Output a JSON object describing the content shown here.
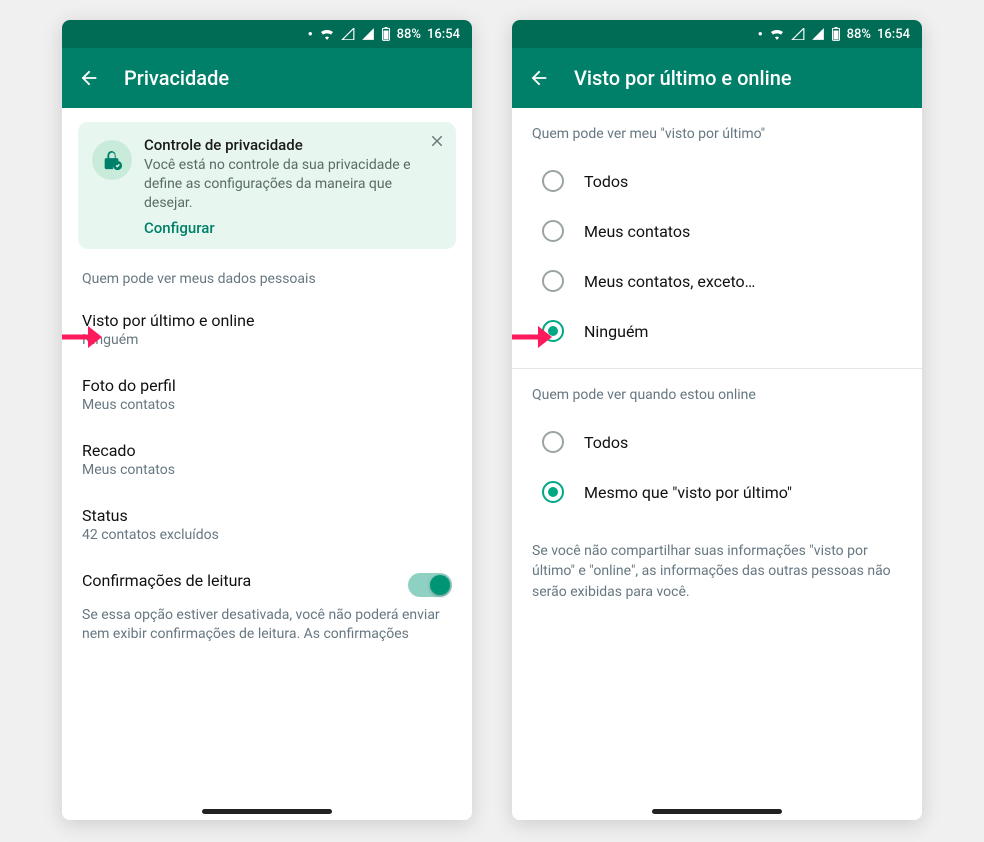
{
  "status": {
    "battery": "88%",
    "time": "16:54"
  },
  "left": {
    "title": "Privacidade",
    "card": {
      "title": "Controle de privacidade",
      "text": "Você está no controle da sua privacidade e define as configurações da maneira que desejar.",
      "link": "Configurar"
    },
    "sectionHeader": "Quem pode ver meus dados pessoais",
    "settings": [
      {
        "title": "Visto por último e online",
        "sub": "Ninguém"
      },
      {
        "title": "Foto do perfil",
        "sub": "Meus contatos"
      },
      {
        "title": "Recado",
        "sub": "Meus contatos"
      },
      {
        "title": "Status",
        "sub": "42 contatos excluídos"
      }
    ],
    "readReceipts": {
      "title": "Confirmações de leitura",
      "desc": "Se essa opção estiver desativada, você não poderá enviar nem exibir confirmações de leitura. As confirmações"
    }
  },
  "right": {
    "title": "Visto por último e online",
    "section1": "Quem pode ver meu \"visto por último\"",
    "options1": [
      {
        "label": "Todos",
        "selected": false
      },
      {
        "label": "Meus contatos",
        "selected": false
      },
      {
        "label": "Meus contatos, exceto…",
        "selected": false
      },
      {
        "label": "Ninguém",
        "selected": true
      }
    ],
    "section2": "Quem pode ver quando estou online",
    "options2": [
      {
        "label": "Todos",
        "selected": false
      },
      {
        "label": "Mesmo que \"visto por último\"",
        "selected": true
      }
    ],
    "note": "Se você não compartilhar suas informações \"visto por último\" e \"online\", as informações das outras pessoas não serão exibidas para você."
  }
}
